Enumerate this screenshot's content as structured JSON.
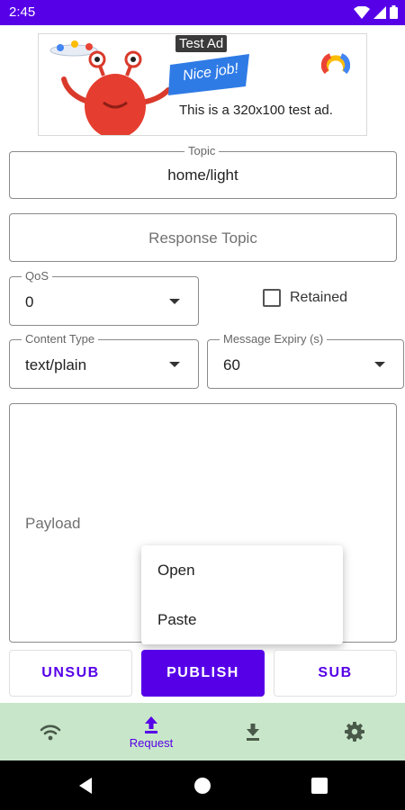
{
  "status_bar": {
    "time": "2:45"
  },
  "ad": {
    "label": "Test Ad",
    "brand_text": "Nice job!",
    "text": "This is a 320x100 test ad."
  },
  "form": {
    "topic": {
      "label": "Topic",
      "value": "home/light"
    },
    "response_topic": {
      "placeholder": "Response Topic"
    },
    "qos": {
      "label": "QoS",
      "value": "0"
    },
    "retained": {
      "label": "Retained",
      "checked": false
    },
    "content_type": {
      "label": "Content Type",
      "value": "text/plain"
    },
    "message_expiry": {
      "label": "Message Expiry (s)",
      "value": "60"
    },
    "payload": {
      "placeholder": "Payload"
    }
  },
  "context_menu": {
    "items": [
      "Open",
      "Paste"
    ]
  },
  "buttons": {
    "unsub": "UNSUB",
    "publish": "PUBLISH",
    "sub": "SUB"
  },
  "bottom_nav": {
    "items": [
      {
        "icon": "wifi-icon",
        "label": ""
      },
      {
        "icon": "upload-icon",
        "label": "Request",
        "active": true
      },
      {
        "icon": "download-icon",
        "label": ""
      },
      {
        "icon": "gear-icon",
        "label": ""
      }
    ]
  },
  "colors": {
    "primary": "#5600e8",
    "nav_background": "#c8e6c9",
    "nav_icon": "#4a5a4a"
  }
}
